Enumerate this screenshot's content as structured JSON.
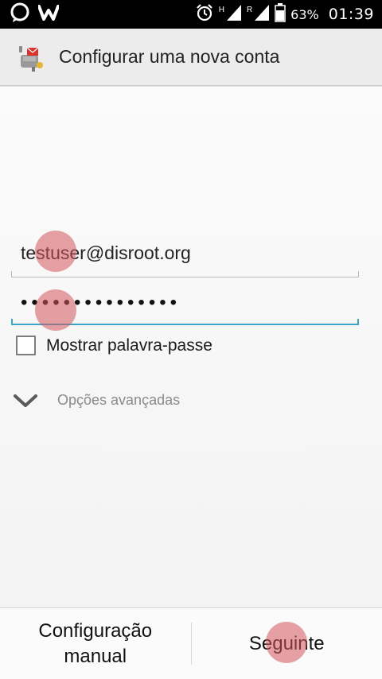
{
  "status_bar": {
    "time": "01:39",
    "battery": "63%",
    "net1": "H",
    "net2": "R"
  },
  "action_bar": {
    "title": "Configurar uma nova conta"
  },
  "form": {
    "email_value": "testuser@disroot.org",
    "password_value": "•••••••••••••••",
    "show_password_label": "Mostrar palavra-passe",
    "show_password_checked": false,
    "advanced_label": "Opções avançadas"
  },
  "buttons": {
    "manual_line1": "Configuração",
    "manual_line2": "manual",
    "next_label": "Seguinte"
  },
  "colors": {
    "accent": "#3aa6c6",
    "touch": "#d2555a"
  }
}
